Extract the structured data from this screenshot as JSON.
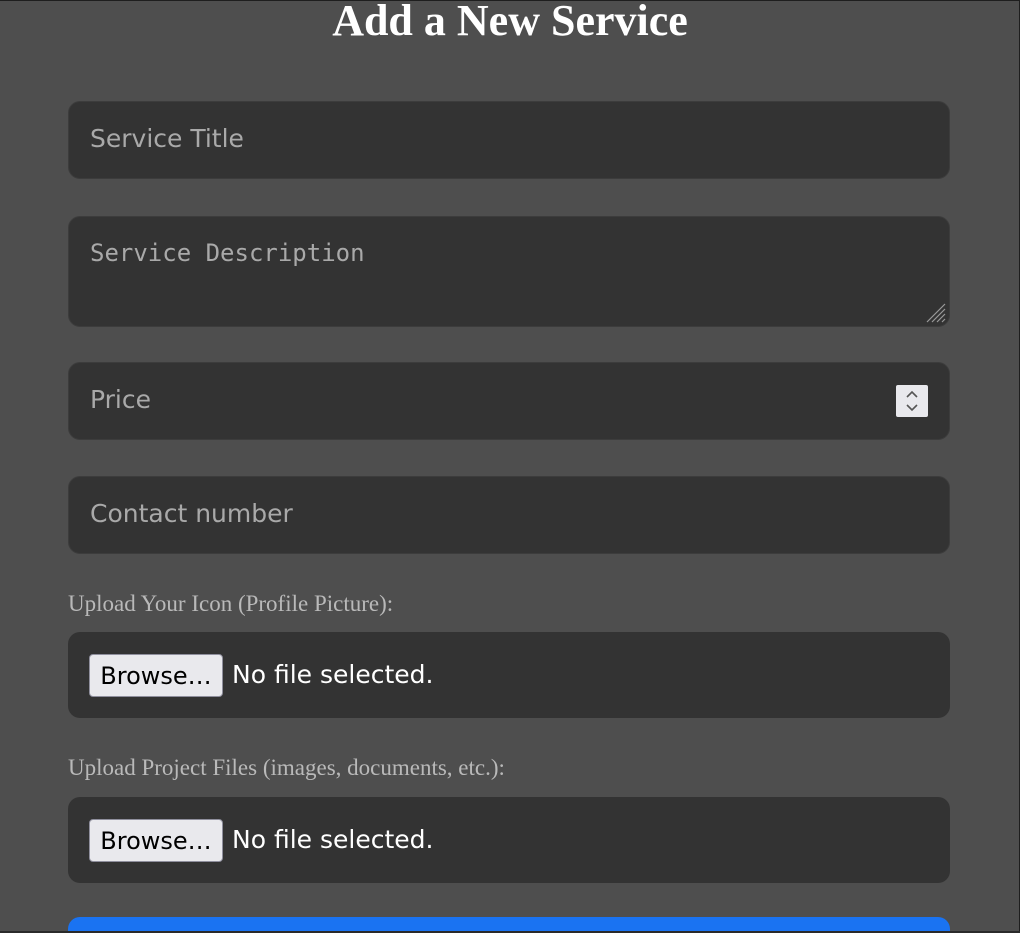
{
  "page": {
    "title": "Add a New Service"
  },
  "form": {
    "service_title_placeholder": "Service Title",
    "service_description_placeholder": "Service Description",
    "price_placeholder": "Price",
    "contact_placeholder": "Contact number",
    "icon_upload": {
      "label": "Upload Your Icon (Profile Picture):",
      "button_label": "Browse…",
      "status": "No file selected."
    },
    "project_files_upload": {
      "label": "Upload Project Files (images, documents, etc.):",
      "button_label": "Browse…",
      "status": "No file selected."
    }
  },
  "icons": {
    "resize": "resize-grip-icon",
    "spinner": "number-spinner-icon"
  },
  "colors": {
    "background": "#4e4e4e",
    "field_background": "#333333",
    "placeholder": "#a9a9a9",
    "submit_accent": "#1a73f2"
  }
}
